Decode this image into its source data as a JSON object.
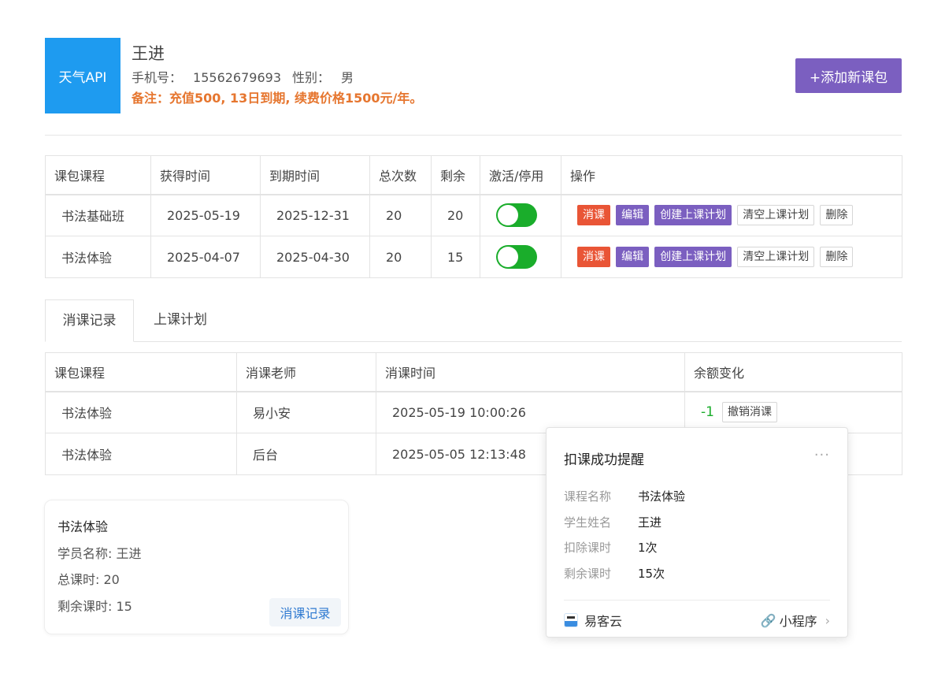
{
  "header": {
    "avatar_text": "天气API",
    "name": "王进",
    "phone_label": "手机号",
    "phone": "15562679693",
    "gender_label": "性别",
    "gender": "男",
    "note": "备注：充值500, 13日到期, 续费价格1500元/年。",
    "add_button": "+添加新课包"
  },
  "packages": {
    "headers": [
      "课包课程",
      "获得时间",
      "到期时间",
      "总次数",
      "剩余",
      "激活/停用",
      "操作"
    ],
    "rows": [
      {
        "course": "书法基础班",
        "obtained": "2025-05-19",
        "expires": "2025-12-31",
        "total": "20",
        "remaining": "20",
        "active": true
      },
      {
        "course": "书法体验",
        "obtained": "2025-04-07",
        "expires": "2025-04-30",
        "total": "20",
        "remaining": "15",
        "active": true
      }
    ],
    "actions": {
      "consume": "消课",
      "edit": "编辑",
      "create_plan": "创建上课计划",
      "clear_plan": "清空上课计划",
      "delete": "删除"
    }
  },
  "tabs": [
    "消课记录",
    "上课计划"
  ],
  "records": {
    "headers": [
      "课包课程",
      "消课老师",
      "消课时间",
      "余额变化"
    ],
    "rows": [
      {
        "course": "书法体验",
        "teacher": "易小安",
        "time": "2025-05-19 10:00:26",
        "change": "-1",
        "revoke": "撤销消课"
      },
      {
        "course": "书法体验",
        "teacher": "后台",
        "time": "2025-05-05 12:13:48"
      }
    ]
  },
  "card": {
    "title": "书法体验",
    "student": "学员名称: 王进",
    "total": "总课时: 20",
    "remaining": "剩余课时: 15",
    "button": "消课记录"
  },
  "popup": {
    "title": "扣课成功提醒",
    "more": "···",
    "rows": [
      {
        "k": "课程名称",
        "v": "书法体验"
      },
      {
        "k": "学生姓名",
        "v": "王进"
      },
      {
        "k": "扣除课时",
        "v": "1次"
      },
      {
        "k": "剩余课时",
        "v": "15次"
      }
    ],
    "brand": "易客云",
    "mini": "小程序"
  }
}
